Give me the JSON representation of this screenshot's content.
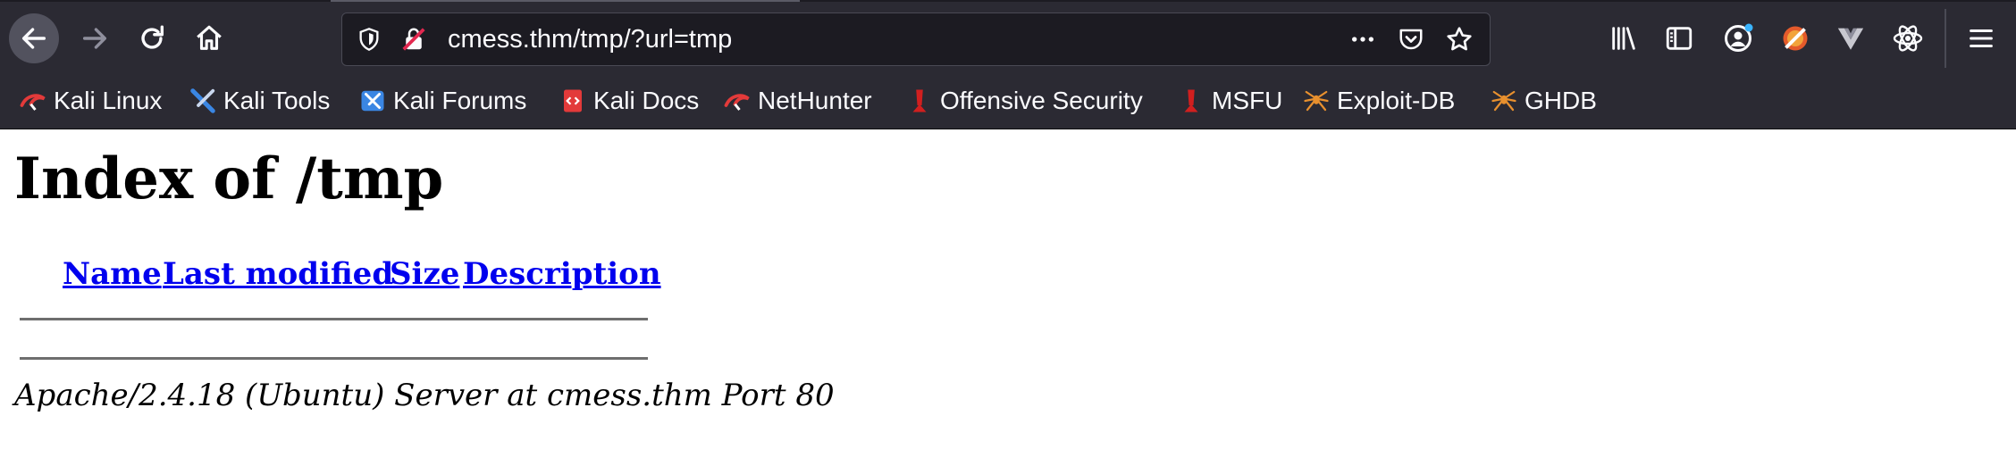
{
  "browser": {
    "url": "cmess.thm/tmp/?url=tmp",
    "bookmarks": [
      {
        "label": "Kali Linux",
        "icon": "kali-dragon-icon"
      },
      {
        "label": "Kali Tools",
        "icon": "kali-tools-icon"
      },
      {
        "label": "Kali Forums",
        "icon": "kali-forums-icon"
      },
      {
        "label": "Kali Docs",
        "icon": "kali-docs-icon"
      },
      {
        "label": "NetHunter",
        "icon": "kali-dragon-icon"
      },
      {
        "label": "Offensive Security",
        "icon": "offsec-icon"
      },
      {
        "label": "MSFU",
        "icon": "offsec-icon"
      },
      {
        "label": "Exploit-DB",
        "icon": "exploit-db-icon"
      },
      {
        "label": "GHDB",
        "icon": "exploit-db-icon"
      }
    ],
    "colors": {
      "chrome": "#2b2a33",
      "urlbar": "#1c1b22",
      "accent": "#3ab4ff"
    }
  },
  "page": {
    "title": "Index of /tmp",
    "columns": [
      "Name",
      "Last modified",
      "Size",
      "Description"
    ],
    "rows": [],
    "address": "Apache/2.4.18 (Ubuntu) Server at cmess.thm Port 80",
    "link_color": "#0000ee"
  }
}
